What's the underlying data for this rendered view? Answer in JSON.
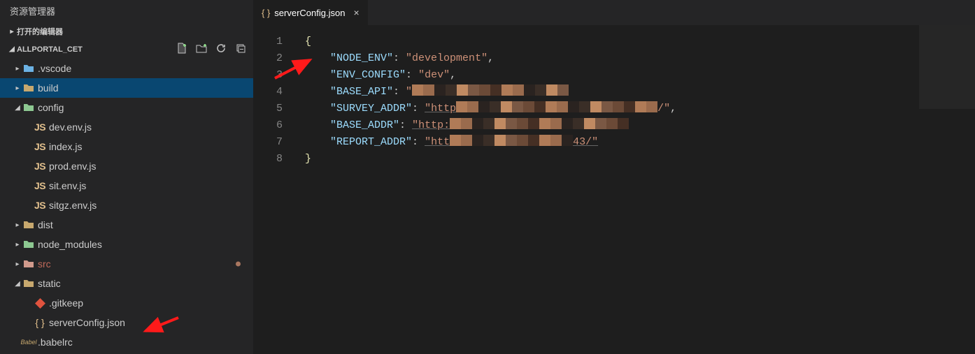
{
  "sidebar": {
    "title": "资源管理器",
    "open_editors_label": "打开的编辑器",
    "project_label": "ALLPORTAL_CET",
    "actions": {
      "new_file": "⧉",
      "new_folder": "🗀",
      "refresh": "⟳",
      "collapse": "⧉"
    },
    "tree": [
      {
        "type": "folder",
        "label": ".vscode",
        "expanded": false,
        "depth": 0,
        "iconClass": "clr-fold-blue",
        "chev": "▸"
      },
      {
        "type": "folder",
        "label": "build",
        "expanded": false,
        "depth": 0,
        "iconClass": "clr-fold-tan",
        "chev": "▸",
        "active": true
      },
      {
        "type": "folder",
        "label": "config",
        "expanded": true,
        "depth": 0,
        "iconClass": "clr-fold-green",
        "chev": "◢"
      },
      {
        "type": "file",
        "label": "dev.env.js",
        "depth": 1,
        "iconKind": "js"
      },
      {
        "type": "file",
        "label": "index.js",
        "depth": 1,
        "iconKind": "js"
      },
      {
        "type": "file",
        "label": "prod.env.js",
        "depth": 1,
        "iconKind": "js"
      },
      {
        "type": "file",
        "label": "sit.env.js",
        "depth": 1,
        "iconKind": "js"
      },
      {
        "type": "file",
        "label": "sitgz.env.js",
        "depth": 1,
        "iconKind": "js"
      },
      {
        "type": "folder",
        "label": "dist",
        "expanded": false,
        "depth": 0,
        "iconClass": "clr-fold-tan",
        "chev": "▸"
      },
      {
        "type": "folder",
        "label": "node_modules",
        "expanded": false,
        "depth": 0,
        "iconClass": "clr-fold-green",
        "chev": "▸"
      },
      {
        "type": "folder",
        "label": "src",
        "expanded": false,
        "depth": 0,
        "iconClass": "clr-fold-red",
        "chev": "▸",
        "labelClass": "clr-src",
        "dirty": true
      },
      {
        "type": "folder",
        "label": "static",
        "expanded": true,
        "depth": 0,
        "iconClass": "clr-fold-tan",
        "chev": "◢"
      },
      {
        "type": "file",
        "label": ".gitkeep",
        "depth": 1,
        "iconKind": "git"
      },
      {
        "type": "file",
        "label": "serverConfig.json",
        "depth": 1,
        "iconKind": "json"
      },
      {
        "type": "file",
        "label": ".babelrc",
        "depth": 0,
        "iconKind": "babel"
      }
    ]
  },
  "tabs": [
    {
      "label": "serverConfig.json",
      "iconKind": "json",
      "active": true
    }
  ],
  "editor": {
    "line_count": 8,
    "lines": {
      "l1": {
        "brace": "{"
      },
      "l2": {
        "key": "\"NODE_ENV\"",
        "val": "\"development\"",
        "comma": ","
      },
      "l3": {
        "key": "\"ENV_CONFIG\"",
        "val": "\"dev\"",
        "comma": ","
      },
      "l4": {
        "key": "\"BASE_API\"",
        "quoteOpen": "\""
      },
      "l5": {
        "key": "\"SURVEY_ADDR\"",
        "valPrefix": "\"http",
        "tailVisible": "/\"",
        "comma": ","
      },
      "l6": {
        "key": "\"BASE_ADDR\"",
        "valPrefix": "\"http:"
      },
      "l7": {
        "key": "\"REPORT_ADDR\"",
        "valPrefix": "\"htt",
        "tailVisible": "43/\""
      },
      "l8": {
        "brace": "}"
      }
    }
  },
  "annotations": {
    "arrow_code": true,
    "arrow_tree": true
  }
}
